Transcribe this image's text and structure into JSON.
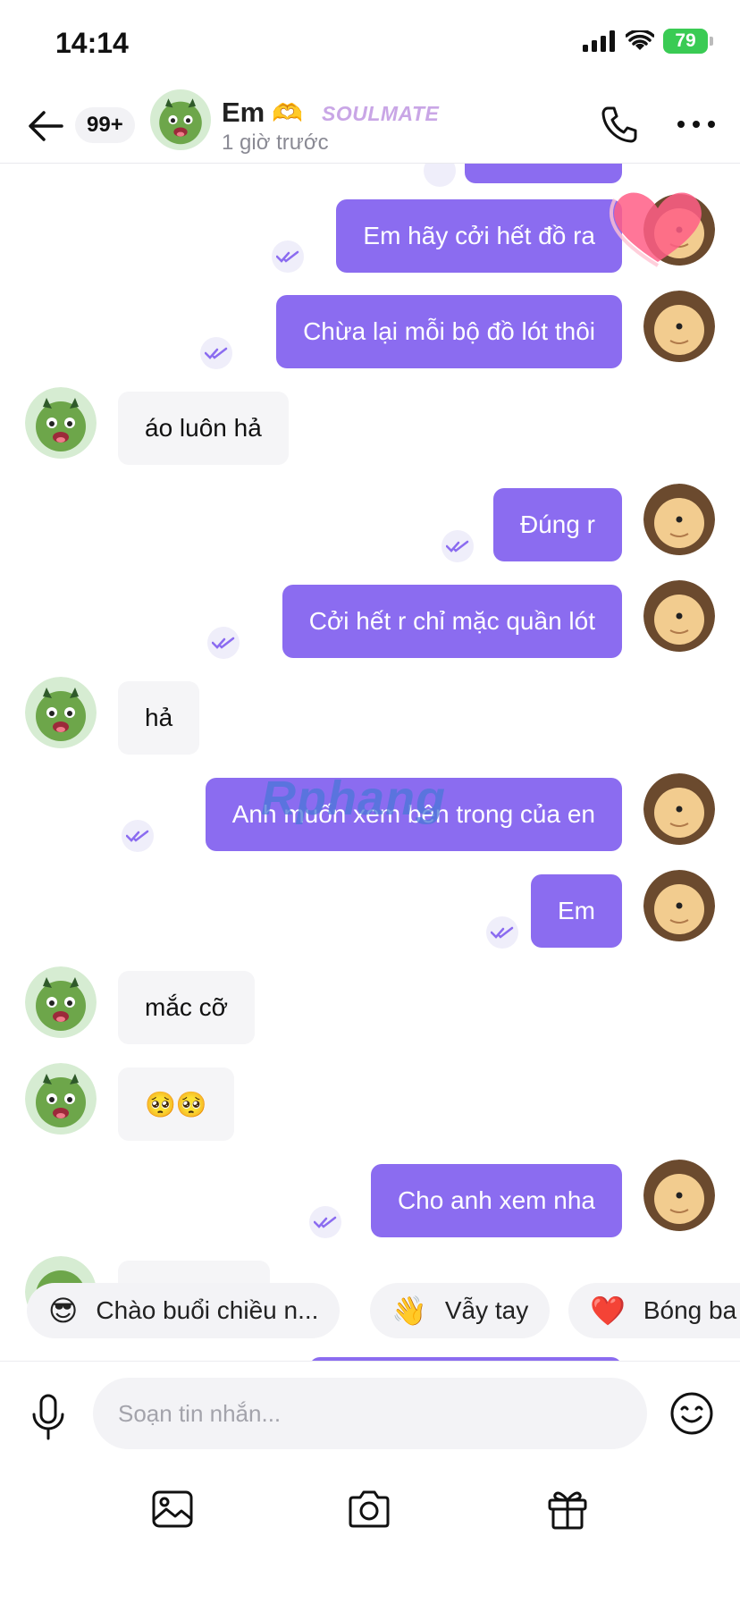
{
  "status_bar": {
    "time": "14:14",
    "battery": "79"
  },
  "header": {
    "unread_count": "99+",
    "contact_name": "Em",
    "heart_emoji": "🫶",
    "tag": "SOULMATE",
    "last_seen": "1 giờ trước"
  },
  "messages": [
    {
      "from": "me",
      "text": "Em hãy cởi hết đồ ra"
    },
    {
      "from": "me",
      "text": "Chừa lại mỗi bộ đồ lót thôi"
    },
    {
      "from": "other",
      "text": "áo luôn hả"
    },
    {
      "from": "me",
      "text": "Đúng r"
    },
    {
      "from": "me",
      "text": "Cởi hết r chỉ mặc quần lót"
    },
    {
      "from": "other",
      "text": "hả"
    },
    {
      "from": "me",
      "text": "Anh muốn xem bên trong của en"
    },
    {
      "from": "me",
      "text": "Em"
    },
    {
      "from": "other",
      "text": "mắc cỡ"
    },
    {
      "from": "other",
      "text": "🥺🥺"
    },
    {
      "from": "me",
      "text": "Cho anh xem nha"
    }
  ],
  "watermark": "Rphang",
  "quick_replies": [
    {
      "emoji": "😎",
      "label": "Chào buổi chiều n..."
    },
    {
      "emoji": "👋",
      "label": "Vẫy tay"
    },
    {
      "emoji": "❤️",
      "label": "Bóng ba"
    }
  ],
  "composer": {
    "placeholder": "Soạn tin nhắn..."
  },
  "icons": [
    "back-arrow-icon",
    "phone-icon",
    "more-icon",
    "mic-icon",
    "smiley-icon",
    "image-icon",
    "camera-icon",
    "gift-icon"
  ],
  "colors": {
    "outgoing_bubble": "#8b6cf0",
    "incoming_bubble": "#f5f5f7",
    "battery": "#3acb54"
  }
}
